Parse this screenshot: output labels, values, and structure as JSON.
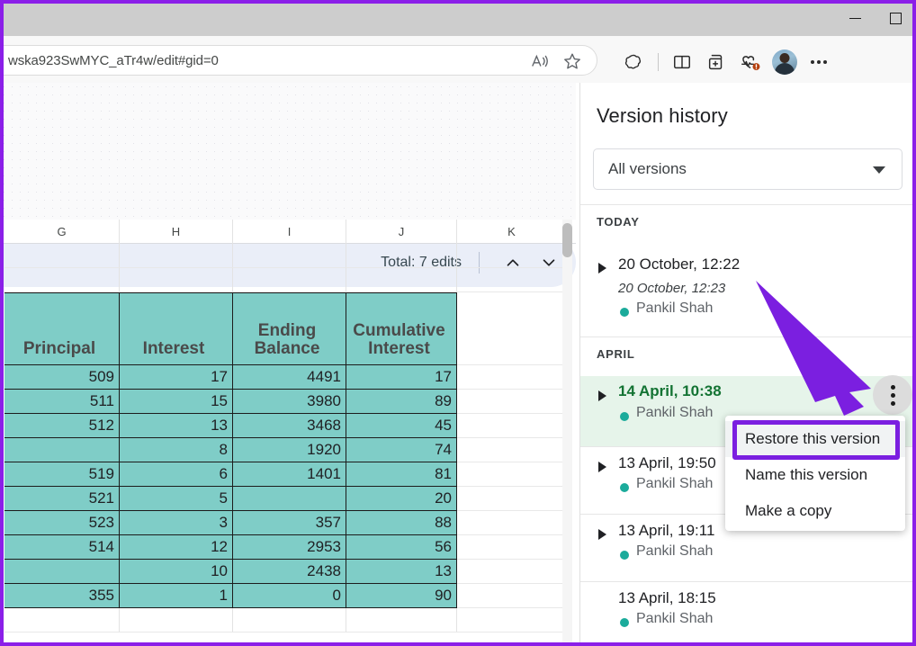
{
  "browser": {
    "window_controls": {
      "minimize": "minimize-button",
      "maximize": "maximize-button"
    },
    "url": "wska923SwMYC_aTr4w/edit#gid=0",
    "toolbar_icons": [
      "read-aloud-icon",
      "favorite-star-icon",
      "copilot-icon",
      "split-screen-icon",
      "add-tab-group-icon",
      "browser-essentials-icon",
      "profile-avatar",
      "settings-more-icon"
    ]
  },
  "sheet": {
    "edits_total": "Total: 7 edits",
    "nav_prev": "chevron-up-icon",
    "nav_next": "chevron-down-icon",
    "columns": [
      "G",
      "H",
      "I",
      "J",
      "K"
    ],
    "headers": [
      "Principal",
      "Interest",
      "Ending Balance",
      "Cumulative Interest"
    ],
    "rows": [
      [
        "509",
        "17",
        "4491",
        "17"
      ],
      [
        "511",
        "15",
        "3980",
        "89"
      ],
      [
        "512",
        "13",
        "3468",
        "45"
      ],
      [
        "",
        "8",
        "1920",
        "74"
      ],
      [
        "519",
        "6",
        "1401",
        "81"
      ],
      [
        "521",
        "5",
        "",
        "20"
      ],
      [
        "523",
        "3",
        "357",
        "88"
      ],
      [
        "514",
        "12",
        "2953",
        "56"
      ],
      [
        "",
        "10",
        "2438",
        "13"
      ],
      [
        "355",
        "1",
        "0",
        "90"
      ]
    ]
  },
  "panel": {
    "title": "Version history",
    "filter_value": "All versions",
    "groups": [
      {
        "label": "TODAY"
      },
      {
        "label": "APRIL"
      }
    ],
    "versions": [
      {
        "title": "20 October, 12:22",
        "subtitle": "20 October, 12:23",
        "author": "Pankil Shah",
        "selected": false,
        "expandable": true
      },
      {
        "title": "14 April, 10:38",
        "subtitle": "",
        "author": "Pankil Shah",
        "selected": true,
        "expandable": true
      },
      {
        "title": "13 April, 19:50",
        "subtitle": "",
        "author": "Pankil Shah",
        "selected": false,
        "expandable": true
      },
      {
        "title": "13 April, 19:11",
        "subtitle": "",
        "author": "Pankil Shah",
        "selected": false,
        "expandable": true
      },
      {
        "title": "13 April, 18:15",
        "subtitle": "",
        "author": "Pankil Shah",
        "selected": false,
        "expandable": false
      }
    ],
    "kebab": "more-options-icon"
  },
  "menu": {
    "items": [
      "Restore this version",
      "Name this version",
      "Make a copy"
    ],
    "highlighted_index": 0
  },
  "colors": {
    "annotation": "#7b1fe0",
    "selected_version_text": "#137333",
    "selected_version_bg": "#e6f4ea",
    "cell_fill": "#7fcdc7",
    "author_dot": "#1bab9b",
    "edits_bar_bg": "#eaeef8"
  }
}
